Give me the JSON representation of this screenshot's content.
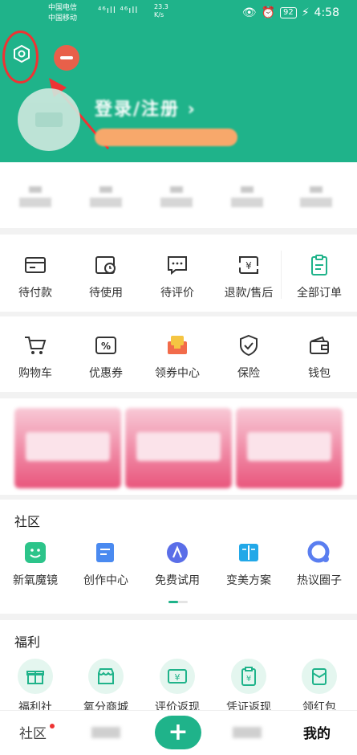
{
  "status_bar": {
    "carrier1": "中国电信",
    "carrier2": "中国移动",
    "signal": "⁴⁶ıll ⁴⁶ıll",
    "speed_value": "23.3",
    "speed_unit": "K/s",
    "battery": "92",
    "time": "4:58"
  },
  "profile": {
    "login_text": "登录/注册",
    "login_chevron": "›"
  },
  "orders": [
    {
      "label": "待付款",
      "icon": "wallet-card-icon"
    },
    {
      "label": "待使用",
      "icon": "clock-card-icon"
    },
    {
      "label": "待评价",
      "icon": "comment-icon"
    },
    {
      "label": "退款/售后",
      "icon": "refund-icon"
    },
    {
      "label": "全部订单",
      "icon": "clipboard-icon"
    }
  ],
  "services": [
    {
      "label": "购物车",
      "icon": "cart-icon"
    },
    {
      "label": "优惠券",
      "icon": "coupon-icon"
    },
    {
      "label": "领券中心",
      "icon": "coupon-center-icon"
    },
    {
      "label": "保险",
      "icon": "shield-icon"
    },
    {
      "label": "钱包",
      "icon": "wallet-icon"
    }
  ],
  "community": {
    "title": "社区",
    "items": [
      {
        "label": "新氧魔镜",
        "icon": "magic-mirror-icon",
        "color": "#2cc48a"
      },
      {
        "label": "创作中心",
        "icon": "create-icon",
        "color": "#4a8af0"
      },
      {
        "label": "免费试用",
        "icon": "free-trial-icon",
        "color": "#5a6ee8"
      },
      {
        "label": "变美方案",
        "icon": "plan-book-icon",
        "color": "#22a8e8"
      },
      {
        "label": "热议圈子",
        "icon": "circle-icon",
        "color": "#5a7ef0"
      }
    ]
  },
  "welfare": {
    "title": "福利",
    "items": [
      {
        "label": "福利社",
        "icon": "gift-icon"
      },
      {
        "label": "氧分商城",
        "icon": "shop-icon"
      },
      {
        "label": "评价返现",
        "icon": "cashback-icon"
      },
      {
        "label": "凭证返现",
        "icon": "voucher-icon"
      },
      {
        "label": "领红包",
        "icon": "red-packet-icon"
      }
    ]
  },
  "bottom_nav": {
    "community": "社区",
    "plus": "+",
    "mine": "我的"
  },
  "colors": {
    "brand": "#1fb38a",
    "annotation": "#e33333"
  }
}
